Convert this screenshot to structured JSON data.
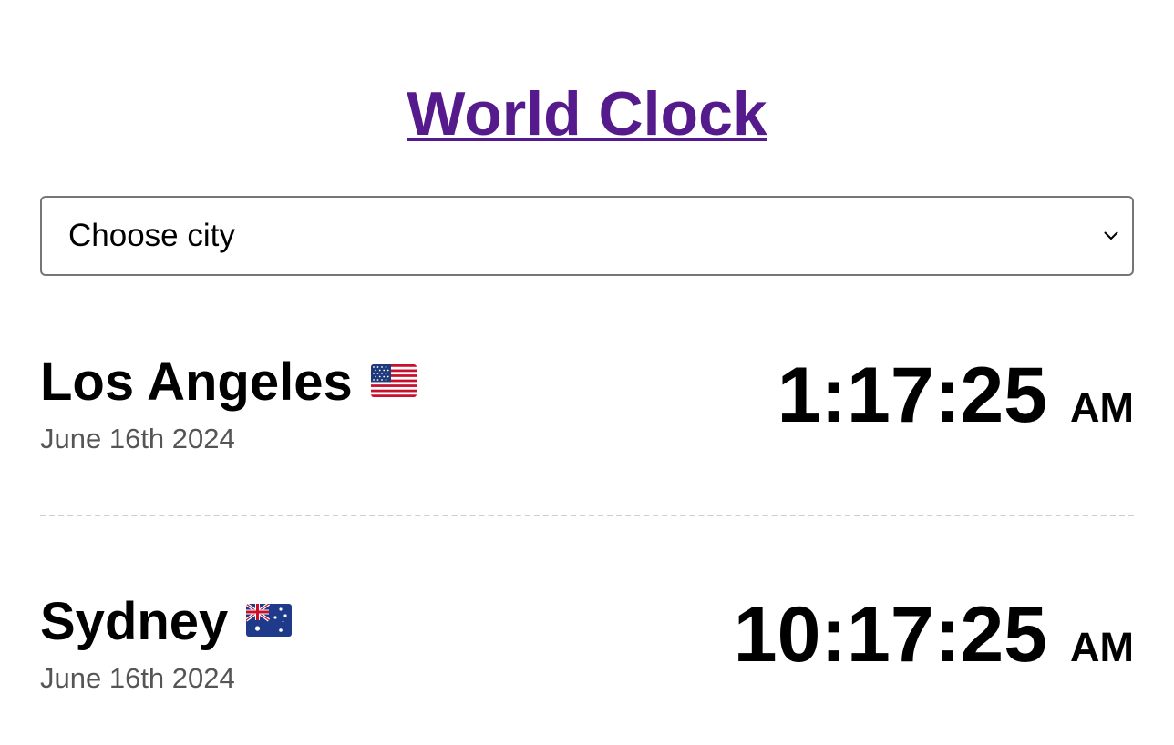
{
  "title": "World Clock",
  "city_select": {
    "selected_label": "Choose city",
    "icon": "chevron-down-icon"
  },
  "clocks": [
    {
      "city": "Los Angeles",
      "flag": "us-flag-icon",
      "date": "June 16th 2024",
      "time": "1:17:25",
      "ampm": "AM"
    },
    {
      "city": "Sydney",
      "flag": "au-flag-icon",
      "date": "June 16th 2024",
      "time": "10:17:25",
      "ampm": "AM"
    }
  ],
  "colors": {
    "title_link": "#551a8b",
    "date_text": "#555555",
    "divider": "#cfcfcf"
  }
}
